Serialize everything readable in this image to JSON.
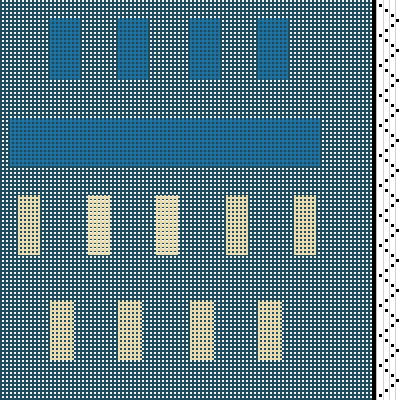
{
  "colors": {
    "canvas_light": "#eef3f0",
    "canvas_dark": "#1f4a5c",
    "motif_blue": "#1a6f9e",
    "motif_cream": "#f1e1b3",
    "strip_background": "#ffffff",
    "strip_marks": "#000000"
  },
  "pattern": {
    "type": "weave-draft-grid",
    "row_groups": [
      {
        "color": "blue",
        "kind": "rectangles",
        "count": 4
      },
      {
        "color": "blue",
        "kind": "band",
        "count": 1
      },
      {
        "color": "cream",
        "kind": "vertical-dashes",
        "count": 5
      },
      {
        "color": "cream",
        "kind": "vertical-dashes",
        "count": 4
      }
    ]
  },
  "side_strip": {
    "label": "threading-draft-strip"
  }
}
